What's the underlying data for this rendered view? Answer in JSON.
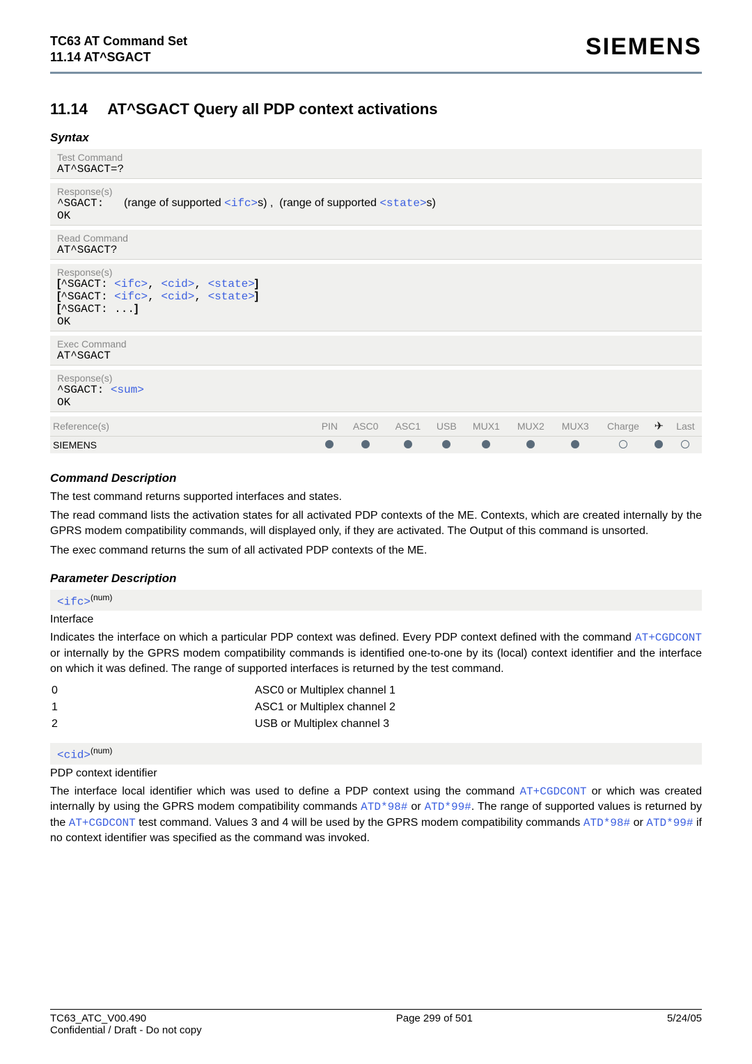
{
  "header": {
    "title": "TC63 AT Command Set",
    "subtitle": "11.14 AT^SGACT",
    "logo": "SIEMENS"
  },
  "section": {
    "number": "11.14",
    "title": "AT^SGACT   Query all PDP context activations"
  },
  "syntax_heading": "Syntax",
  "labels": {
    "test_command": "Test Command",
    "responses": "Response(s)",
    "read_command": "Read Command",
    "exec_command": "Exec Command",
    "references": "Reference(s)"
  },
  "syntax": {
    "test_cmd": "AT^SGACT=?",
    "test_resp_prefix": "^SGACT:   ",
    "plain1": "(range of supported ",
    "link_ifc": "<ifc>",
    "plain2": "s) ,  (range of supported ",
    "link_state": "<state>",
    "plain3": "s)",
    "ok": "OK",
    "read_cmd": "AT^SGACT?",
    "read_line1_open": "[",
    "read_line_prefix": "^SGACT: ",
    "link_cid": "<cid>",
    "comma": ", ",
    "close": "]",
    "read_line_dots": "[^SGACT: ...]",
    "exec_cmd": "AT^SGACT",
    "exec_resp_prefix": "^SGACT: ",
    "link_sum": "<sum>"
  },
  "ref": {
    "headers": [
      "PIN",
      "ASC0",
      "ASC1",
      "USB",
      "MUX1",
      "MUX2",
      "MUX3",
      "Charge",
      "",
      "Last"
    ],
    "name": "SIEMENS"
  },
  "cmd_desc_heading": "Command Description",
  "cmd_desc_p1": "The test command returns supported interfaces and states.",
  "cmd_desc_p2a": "The read command lists the activation states for all activated PDP contexts of the ME. Contexts, which are created internally by the GPRS modem compatibility commands, will displayed only, if they are activated. The Output of this command is unsorted.",
  "cmd_desc_p3": "The exec command returns the sum of all activated PDP contexts of the ME.",
  "param_desc_heading": "Parameter Description",
  "ifc": {
    "tag": "<ifc>",
    "numsup": "(num)",
    "label": "Interface",
    "desc_a": "Indicates the interface on which a particular PDP context was defined. Every PDP context defined with the command ",
    "link1": "AT+CGDCONT",
    "desc_b": " or internally by the GPRS modem compatibility commands is identified one-to-one by its (local) context identifier and the interface on which it was defined. The range of supported interfaces is returned by the test command.",
    "vals": [
      {
        "k": "0",
        "v": "ASC0 or Multiplex channel 1"
      },
      {
        "k": "1",
        "v": "ASC1 or Multiplex channel 2"
      },
      {
        "k": "2",
        "v": "USB or Multiplex channel 3"
      }
    ]
  },
  "cid": {
    "tag": "<cid>",
    "numsup": "(num)",
    "label": "PDP context identifier",
    "desc_a": "The interface local identifier which was used to define a PDP context using the command ",
    "link1": "AT+CGDCONT",
    "desc_b": " or which was created internally by using the GPRS modem compatibility commands ",
    "link2": "ATD*98#",
    "or": " or ",
    "link3": "ATD*99#",
    "desc_c": ". The range of supported values is returned by the ",
    "desc_d": " test command. Values 3 and 4 will be used by the GPRS modem compatibility commands ",
    "desc_e": " if no context identifier was specified as the command was invoked."
  },
  "footer": {
    "left1": "TC63_ATC_V00.490",
    "left2": "Confidential / Draft - Do not copy",
    "center": "Page 299 of 501",
    "right": "5/24/05"
  }
}
